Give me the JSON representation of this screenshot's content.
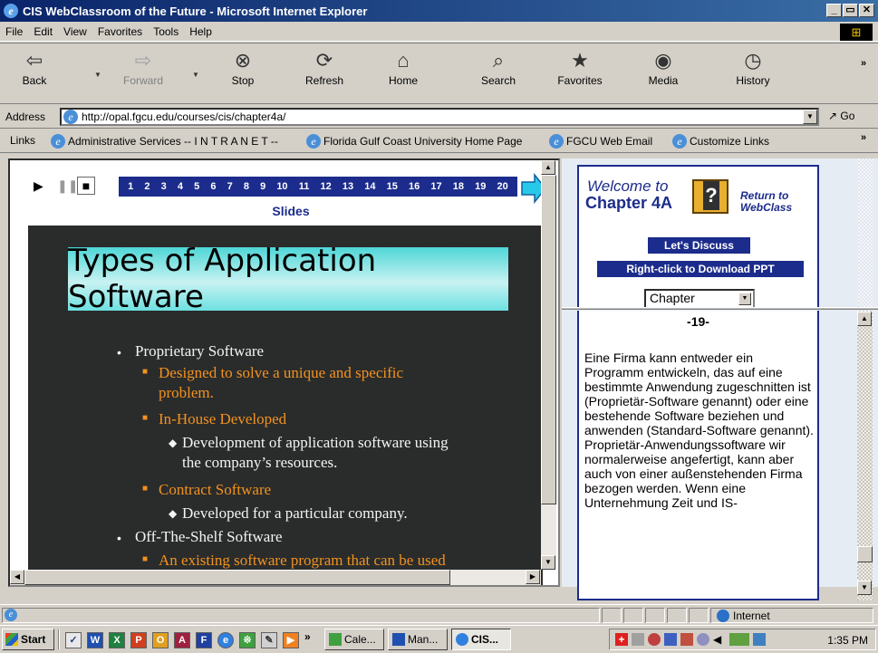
{
  "window": {
    "title": "CIS WebClassroom of the Future - Microsoft Internet Explorer"
  },
  "menu": [
    "File",
    "Edit",
    "View",
    "Favorites",
    "Tools",
    "Help"
  ],
  "toolbar": {
    "back": "Back",
    "forward": "Forward",
    "stop": "Stop",
    "refresh": "Refresh",
    "home": "Home",
    "search": "Search",
    "favorites": "Favorites",
    "media": "Media",
    "history": "History"
  },
  "address": {
    "label": "Address",
    "url": "http://opal.fgcu.edu/courses/cis/chapter4a/",
    "go": "Go"
  },
  "links": {
    "label": "Links",
    "items": [
      "Administrative Services -- I N T R A N E T --",
      "Florida Gulf Coast University Home Page",
      "FGCU Web Email",
      "Customize Links"
    ]
  },
  "player": {
    "slide_numbers": [
      "1",
      "2",
      "3",
      "4",
      "5",
      "6",
      "7",
      "8",
      "9",
      "10",
      "11",
      "12",
      "13",
      "14",
      "15",
      "16",
      "17",
      "18",
      "19",
      "20"
    ],
    "slides_label": "Slides"
  },
  "slide": {
    "title": "Types of Application Software",
    "lines": [
      "Proprietary Software",
      "Designed to solve a unique and specific",
      "problem.",
      "In-House Developed",
      "Development of application software using",
      "the company’s resources.",
      "Contract Software",
      "Developed for a particular company.",
      "Off-The-Shelf Software",
      "An existing software program that can be used"
    ],
    "number": "4"
  },
  "welcome": {
    "line1": "Welcome to",
    "line2": "Chapter 4A",
    "return_line1": "Return to",
    "return_line2": "WebClass",
    "discuss": "Let's Discuss",
    "download": "Right-click to Download PPT",
    "chapter_select": "Chapter"
  },
  "notes": {
    "number": "-19-",
    "text": "Eine Firma kann entweder ein Programm entwickeln, das auf eine bestimmte Anwendung zugeschnitten ist (Proprietär-Software genannt) oder eine bestehende Software beziehen und anwenden (Standard-Software genannt). Proprietär-Anwendungssoftware wir normalerweise angefertigt, kann aber auch von einer außenstehenden Firma bezogen werden. Wenn eine Unternehmung Zeit und IS-"
  },
  "status": {
    "zone": "Internet"
  },
  "taskbar": {
    "start": "Start",
    "tasks": [
      "Cale...",
      "Man...",
      "CIS..."
    ],
    "clock": "1:35 PM"
  }
}
